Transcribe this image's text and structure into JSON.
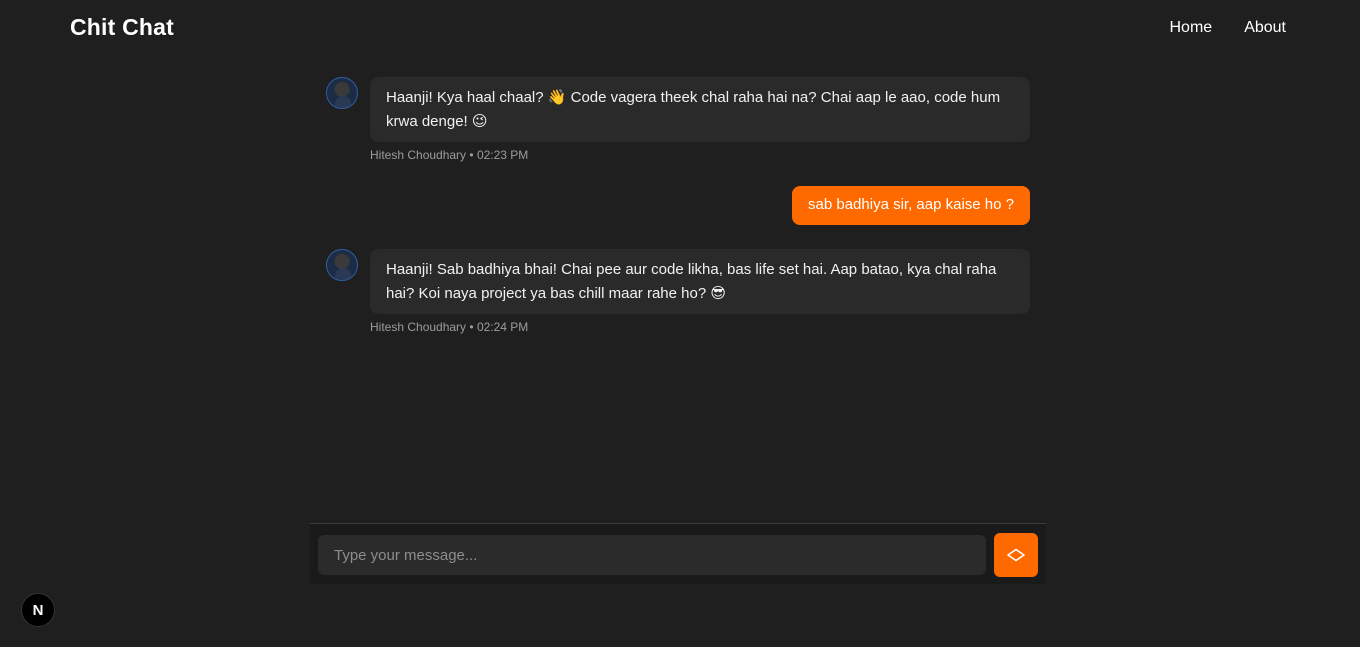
{
  "header": {
    "brand": "Chit Chat",
    "nav": [
      "Home",
      "About"
    ]
  },
  "messages": [
    {
      "role": "bot",
      "text": "Haanji! Kya haal chaal? 👋 Code vagera theek chal raha hai na? Chai aap le aao, code hum krwa denge! 😉",
      "author": "Hitesh Choudhary",
      "time": "02:23 PM"
    },
    {
      "role": "user",
      "text": "sab badhiya sir, aap kaise ho ?"
    },
    {
      "role": "bot",
      "text": "Haanji! Sab badhiya bhai! Chai pee aur code likha, bas life set hai. Aap batao, kya chal raha hai? Koi naya project ya bas chill maar rahe ho? 😎",
      "author": "Hitesh Choudhary",
      "time": "02:24 PM"
    }
  ],
  "composer": {
    "placeholder": "Type your message..."
  },
  "badge": {
    "label": "N"
  },
  "icons": {
    "avatar": "avatar-icon",
    "send": "send-icon"
  },
  "colors": {
    "accent": "#ff6a00",
    "background": "#1f1f1f",
    "bubble": "#2a2a2a"
  }
}
